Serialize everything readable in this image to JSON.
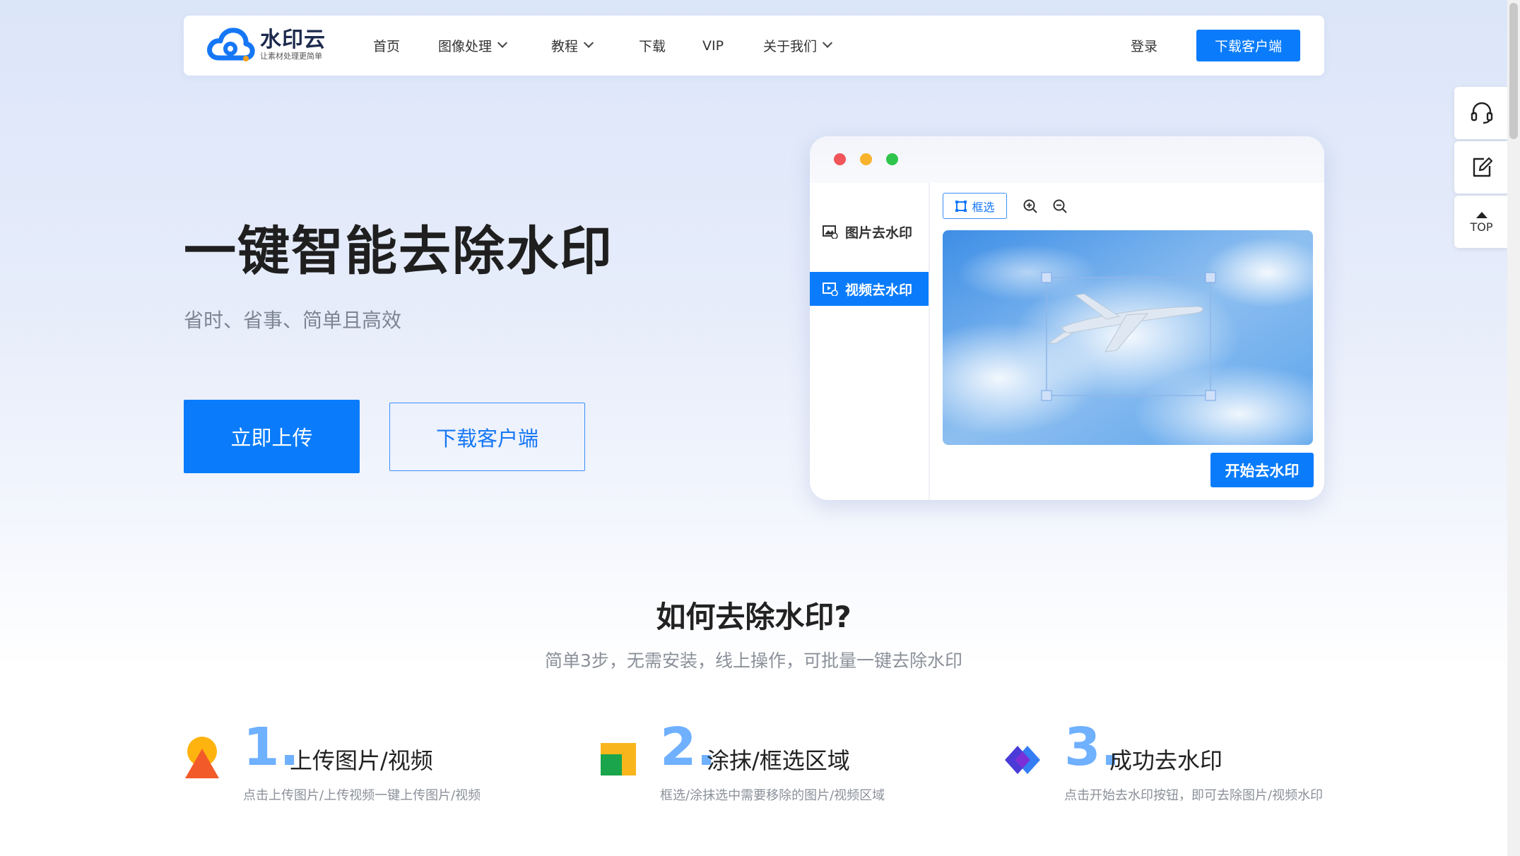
{
  "brand": {
    "name": "水印云",
    "slogan": "让素材处理更简单",
    "color": "#0a7cfb"
  },
  "nav": {
    "items": [
      {
        "label": "首页",
        "has_dropdown": false
      },
      {
        "label": "图像处理",
        "has_dropdown": true
      },
      {
        "label": "教程",
        "has_dropdown": true
      },
      {
        "label": "下载",
        "has_dropdown": false
      },
      {
        "label": "VIP",
        "has_dropdown": false
      },
      {
        "label": "关于我们",
        "has_dropdown": true
      }
    ],
    "login": "登录",
    "download_button": "下载客户端"
  },
  "hero": {
    "title": "一键智能去除水印",
    "subtitle": "省时、省事、简单且高效",
    "upload_button": "立即上传",
    "client_button": "下载客户端"
  },
  "mockup": {
    "window_dots": [
      "#f0555a",
      "#f7b32b",
      "#2fc54d"
    ],
    "sidebar": [
      {
        "label": "图片去水印",
        "active": false,
        "icon": "image-icon"
      },
      {
        "label": "视频去水印",
        "active": true,
        "icon": "video-icon"
      }
    ],
    "toolbar": {
      "select_label": "框选",
      "zoom_in_icon": "zoom-in-icon",
      "zoom_out_icon": "zoom-out-icon"
    },
    "start_button": "开始去水印"
  },
  "float_bar": {
    "service_icon": "headset-icon",
    "feedback_icon": "edit-icon",
    "top_label": "TOP"
  },
  "how": {
    "title": "如何去除水印?",
    "subtitle": "简单3步，无需安装，线上操作，可批量一键去除水印",
    "steps": [
      {
        "num": "1.",
        "name": "上传图片/视频",
        "desc": "点击上传图片/上传视频一键上传图片/视频",
        "icon": "shapes-icon"
      },
      {
        "num": "2.",
        "name": "涂抹/框选区域",
        "desc": "框选/涂抹选中需要移除的图片/视频区域",
        "icon": "squares-icon"
      },
      {
        "num": "3.",
        "name": "成功去水印",
        "desc": "点击开始去水印按钮，即可去除图片/视频水印",
        "icon": "diamonds-icon"
      }
    ]
  }
}
